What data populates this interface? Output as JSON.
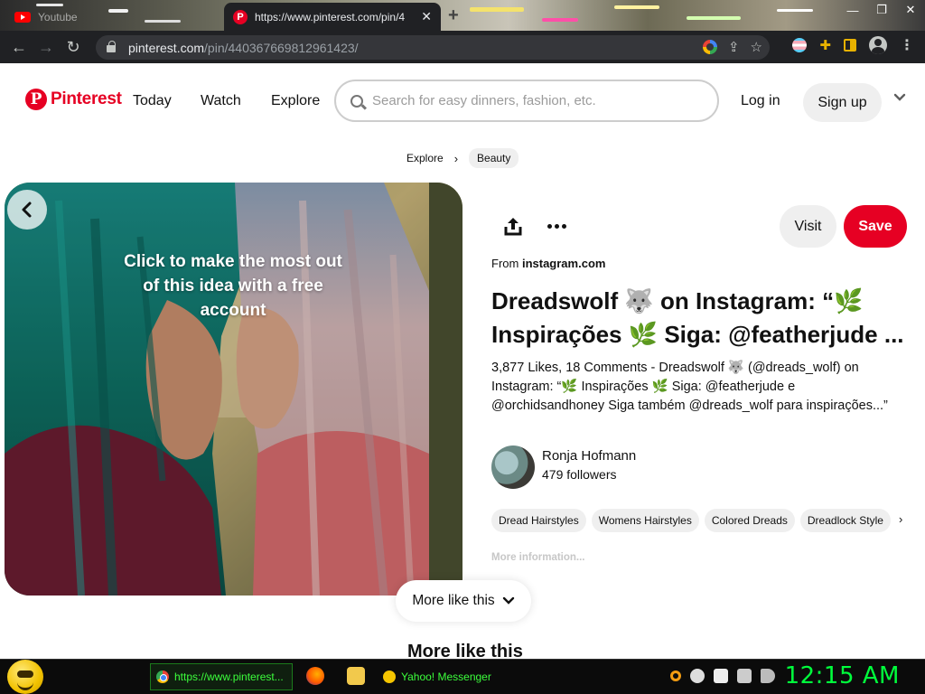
{
  "browser": {
    "tabs": [
      {
        "label": "Youtube",
        "active": false
      },
      {
        "label": "https://www.pinterest.com/pin/4",
        "active": true
      }
    ],
    "address": {
      "host": "pinterest.com",
      "path": "/pin/440367669812961423/"
    }
  },
  "header": {
    "logo": "Pinterest",
    "nav": [
      "Today",
      "Watch",
      "Explore"
    ],
    "search_placeholder": "Search for easy dinners, fashion, etc.",
    "login": "Log in",
    "signup": "Sign up"
  },
  "breadcrumb": [
    "Explore",
    "Beauty"
  ],
  "pin": {
    "overlay_text": "Click to make the most out of this idea with a free account",
    "visit": "Visit",
    "save": "Save",
    "from_prefix": "From",
    "from_source": "instagram.com",
    "title": "Dreadswolf 🐺 on Instagram: “🌿 Inspirações 🌿 Siga: @featherjude ...",
    "description": "3,877 Likes, 18 Comments - Dreadswolf 🐺 (@dreads_wolf) on Instagram: “🌿 Inspirações 🌿 Siga: @featherjude e @orchidsandhoney Siga também @dreads_wolf para inspirações...”",
    "creator_name": "Ronja Hofmann",
    "creator_followers": "479 followers",
    "tags": [
      "Dread Hairstyles",
      "Womens Hairstyles",
      "Colored Dreads",
      "Dreadlock Style"
    ],
    "more_info": "More information...",
    "more_like_this_button": "More like this",
    "more_like_this_heading": "More like this"
  },
  "taskbar": {
    "chrome_label": "https://www.pinterest...",
    "yahoo_label": "Yahoo! Messenger",
    "clock": "12:15 AM"
  },
  "colors": {
    "brand": "#e60023",
    "taskbar_text": "#3cff3c",
    "clock": "#00ff3c"
  }
}
